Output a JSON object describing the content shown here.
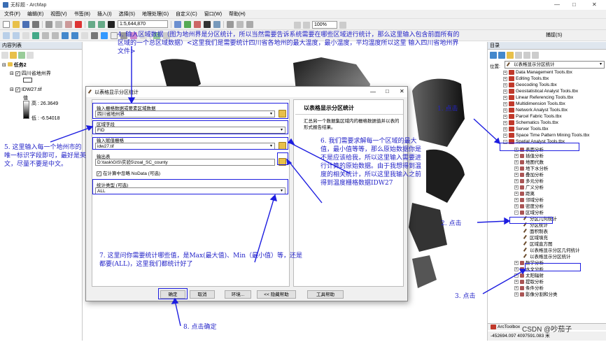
{
  "window": {
    "title": "无标题 - ArcMap",
    "minimize": "—",
    "maximize": "□",
    "close": "✕"
  },
  "menu": [
    "文件(F)",
    "编辑(E)",
    "视图(V)",
    "书签(B)",
    "插入(I)",
    "选择(S)",
    "地理处理(G)",
    "自定义(C)",
    "窗口(W)",
    "帮助(H)"
  ],
  "toolbar": {
    "scale": "1:5,644,870",
    "zoom": "100%",
    "capture_label": "捕捉(S)"
  },
  "left_pane": {
    "header": "内容列表",
    "layers_root": "任务2",
    "layer1": "四川省地州界",
    "layer2": "IDW27.tif",
    "value_label": "值",
    "high": "高 : 26.3649",
    "low": "低 : -6.54018"
  },
  "right_pane": {
    "header": "目录",
    "location_label": "位置:",
    "location_value": "以表格显示分区统计",
    "items": [
      "Data Management Tools.tbx",
      "Editing Tools.tbx",
      "Geocoding Tools.tbx",
      "Geostatistical Analyst Tools.tbx",
      "Linear Referencing Tools.tbx",
      "Multidimension Tools.tbx",
      "Network Analyst Tools.tbx",
      "Parcel Fabric Tools.tbx",
      "Schematics Tools.tbx",
      "Server Tools.tbx",
      "Space Time Pattern Mining Tools.tbx",
      "Spatial Analyst Tools.tbx"
    ],
    "sub_items": [
      "表面分析",
      "插值分析",
      "地图代数",
      "地下水分析",
      "叠加分析",
      "多元分析",
      "广义分析",
      "距离",
      "邻域分析",
      "密度分析",
      "区域分析"
    ],
    "zonal_items": [
      "分区几何统计",
      "分区统计",
      "面积制表",
      "区域填充",
      "区域直方图",
      "以表格显示分区几何统计",
      "以表格显示分区统计"
    ],
    "more_items": [
      "数学分析",
      "水文分析",
      "太阳辐射",
      "提取分析",
      "条件分析",
      "影像分割和分类"
    ],
    "bottom_tab": "ArcToolbox",
    "coords": "-452694.097  4097591.083 米"
  },
  "dialog": {
    "title": "以表格显示分区统计",
    "label_zone": "输入栅格数据或要素区域数据",
    "zone_value": "四川省地州界",
    "label_field": "区域字段",
    "field_value": "FID",
    "label_raster": "输入赋值栅格",
    "raster_value": "idw27.tif",
    "label_output": "输出表",
    "output_value": "D:\\task\\GIS\\实验5\\zoal_SC_county",
    "nodata_label": "在计算中忽略 NoData (可选)",
    "label_stats": "统计类型 (可选)",
    "stats_value": "ALL",
    "help_title": "以表格显示分区统计",
    "help_text": "汇总另一个数据集区域内的栅格数据值并以表的形式报告结果。",
    "buttons": [
      "确定",
      "取消",
      "环境...",
      "<< 隐藏帮助",
      "工具帮助"
    ]
  },
  "annotations": {
    "a4": "4. 输入区域数据（图为地州界是分区统计，所以当然需要告诉系统需要在哪些区域进行统计，那么这里输入包含前面所有的区域的一个总区域数据）<这里我们是需要统计四川省各地州的最大温度，最小温度，平均温度所以这里 输入四川省地州界 文件>",
    "a1": "1. 点击",
    "a2": "2. 点击",
    "a3": "3. 点击",
    "a5": "5. 这里输入每一个地州市的唯一标识字段即可，最好是英文，尽量不要是中文。",
    "a6": "6. 我们需要求解每一个区域的最大值，最小值等等，那么原始数据你是不是应该给我，所以这里输入需要进行计算的原始数据。由于我想得到温度的相关统计，所以这里我输入之前得到温度栅格数据IDW27",
    "a7": "7. 这里问你需要统计哪些值，是Max(最大值)、Min（最小值）等，还是都要(ALL)，这里我们都统计好了",
    "a8": "8. 点击确定"
  },
  "watermark": "CSDN @吵茄子"
}
